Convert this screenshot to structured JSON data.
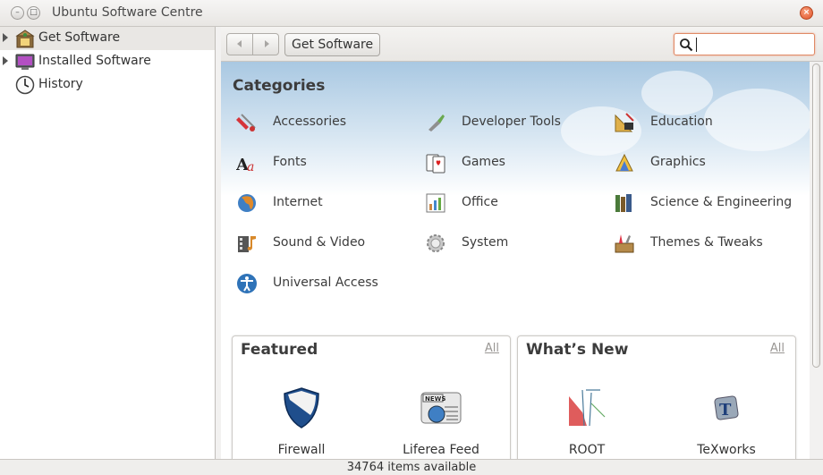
{
  "window": {
    "title": "Ubuntu Software Centre"
  },
  "sidebar": {
    "items": [
      {
        "label": "Get Software",
        "icon": "get-software-icon",
        "selected": true,
        "expandable": true
      },
      {
        "label": "Installed Software",
        "icon": "installed-software-icon",
        "selected": false,
        "expandable": true
      },
      {
        "label": "History",
        "icon": "history-clock-icon",
        "selected": false,
        "expandable": false
      }
    ]
  },
  "toolbar": {
    "breadcrumb": "Get Software",
    "search_value": ""
  },
  "categories": {
    "heading": "Categories",
    "items": [
      {
        "label": "Accessories",
        "icon": "accessories-icon"
      },
      {
        "label": "Developer Tools",
        "icon": "developer-tools-icon"
      },
      {
        "label": "Education",
        "icon": "education-icon"
      },
      {
        "label": "Fonts",
        "icon": "fonts-icon"
      },
      {
        "label": "Games",
        "icon": "games-icon"
      },
      {
        "label": "Graphics",
        "icon": "graphics-icon"
      },
      {
        "label": "Internet",
        "icon": "internet-icon"
      },
      {
        "label": "Office",
        "icon": "office-icon"
      },
      {
        "label": "Science & Engineering",
        "icon": "science-icon"
      },
      {
        "label": "Sound & Video",
        "icon": "sound-video-icon"
      },
      {
        "label": "System",
        "icon": "system-gear-icon"
      },
      {
        "label": "Themes & Tweaks",
        "icon": "themes-tweaks-icon"
      },
      {
        "label": "Universal Access",
        "icon": "universal-access-icon"
      }
    ]
  },
  "featured": {
    "title": "Featured",
    "all_label": "All",
    "apps": [
      {
        "label": "Firewall",
        "icon": "firewall-shield-icon"
      },
      {
        "label": "Liferea Feed",
        "icon": "liferea-news-icon"
      }
    ]
  },
  "whats_new": {
    "title": "What’s New",
    "all_label": "All",
    "apps": [
      {
        "label": "ROOT",
        "icon": "root-icon"
      },
      {
        "label": "TeXworks",
        "icon": "texworks-icon"
      }
    ]
  },
  "status": {
    "text": "34764 items available"
  },
  "colors": {
    "accent": "#e05a2b",
    "sky": "#a9c8e2",
    "selection": "#e9e7e4"
  }
}
